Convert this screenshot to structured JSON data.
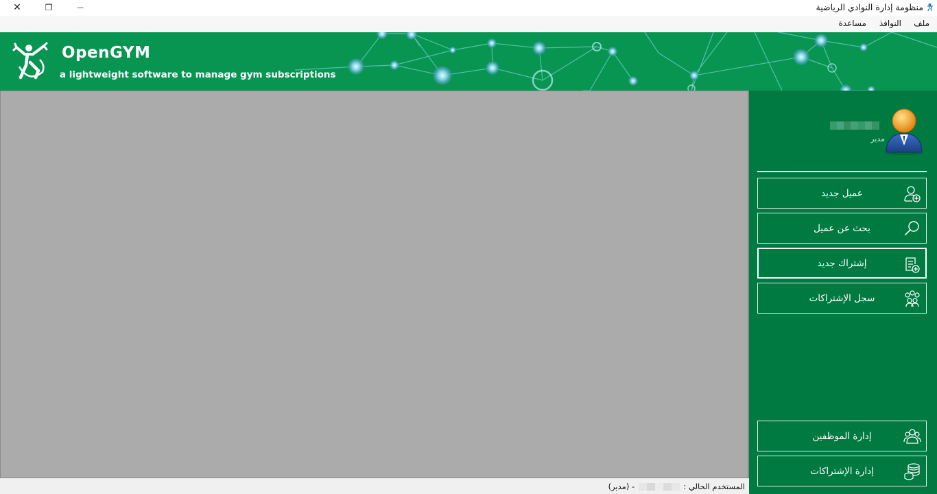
{
  "window": {
    "title": "منظومة إدارة النوادي الرياضية",
    "controls": {
      "close": "✕",
      "maximize": "❐",
      "minimize": "—"
    }
  },
  "menubar": {
    "items": [
      "ملف",
      "النوافذ",
      "مساعدة"
    ]
  },
  "banner": {
    "brand": "OpenGYM",
    "tagline": "a lightweight software to manage gym subscriptions",
    "color": "#089552"
  },
  "sidebar": {
    "user": {
      "role": "مدير"
    },
    "buttons": [
      {
        "label": "عميل جديد",
        "icon": "add-user-icon"
      },
      {
        "label": "بحث عن عميل",
        "icon": "search-icon"
      },
      {
        "label": "إشتراك جديد",
        "icon": "new-subscription-icon"
      },
      {
        "label": "سجل الإشتراكات",
        "icon": "group-icon"
      }
    ],
    "bottom_buttons": [
      {
        "label": "إدارة الموظفين",
        "icon": "staff-icon"
      },
      {
        "label": "إدارة الإشتراكات",
        "icon": "coins-stack-icon"
      }
    ],
    "color": "#007a41"
  },
  "statusbar": {
    "label": "المستخدم الحالي :",
    "role_suffix": "- (مدير)"
  }
}
